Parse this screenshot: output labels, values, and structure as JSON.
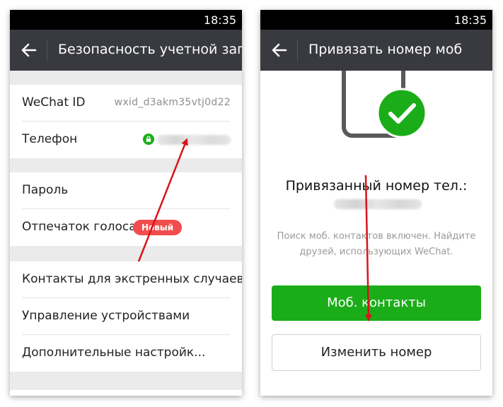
{
  "left": {
    "status_time": "18:35",
    "title": "Безопасность учетной зап...",
    "account": {
      "wechat_id_label": "WeChat ID",
      "wechat_id_value": "wxid_d3akm35vtj0d22",
      "phone_label": "Телефон"
    },
    "security": {
      "password_label": "Пароль",
      "voiceprint_label": "Отпечаток голоса",
      "new_badge": "Новый"
    },
    "more": {
      "emergency_label": "Контакты для экстренных случаев",
      "devices_label": "Управление устройствами",
      "advanced_label": "Дополнительные настройк..."
    }
  },
  "right": {
    "status_time": "18:35",
    "title": "Привязать номер моб",
    "bound_title": "Привязанный номер тел.:",
    "info_line1": "Поиск моб. контактов включен. Найдите",
    "info_line2": "друзей, использующих WeChat.",
    "contacts_button": "Моб. контакты",
    "change_button": "Изменить номер"
  },
  "colors": {
    "appbar": "#393a3f",
    "accent_green": "#1aad19",
    "badge_red": "#f24d4d",
    "arrow_red": "#d9141a"
  }
}
